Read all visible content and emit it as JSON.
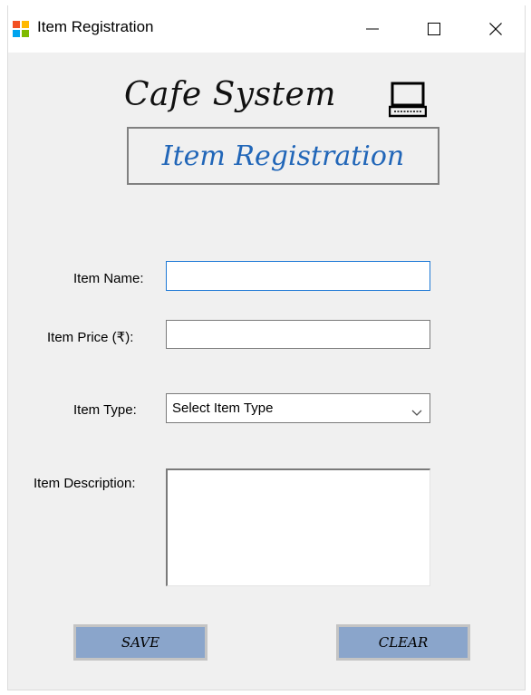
{
  "window": {
    "title": "Item Registration",
    "controls": {
      "minimize": "minimize",
      "maximize": "maximize",
      "close": "close"
    }
  },
  "header": {
    "title": "Cafe System",
    "icon": "laptop-icon",
    "subtitle": "Item Registration"
  },
  "form": {
    "item_name": {
      "label": "Item Name:",
      "value": ""
    },
    "item_price": {
      "label": "Item Price (₹):",
      "value": ""
    },
    "item_type": {
      "label": "Item Type:",
      "selected": "Select Item Type"
    },
    "item_description": {
      "label": "Item Description:",
      "value": ""
    }
  },
  "buttons": {
    "save": "SAVE",
    "clear": "CLEAR"
  },
  "colors": {
    "button_bg": "#8aa5cb",
    "subtitle_text": "#2166b8",
    "focus_border": "#1e79d6",
    "window_bg": "#f0f0f0"
  }
}
